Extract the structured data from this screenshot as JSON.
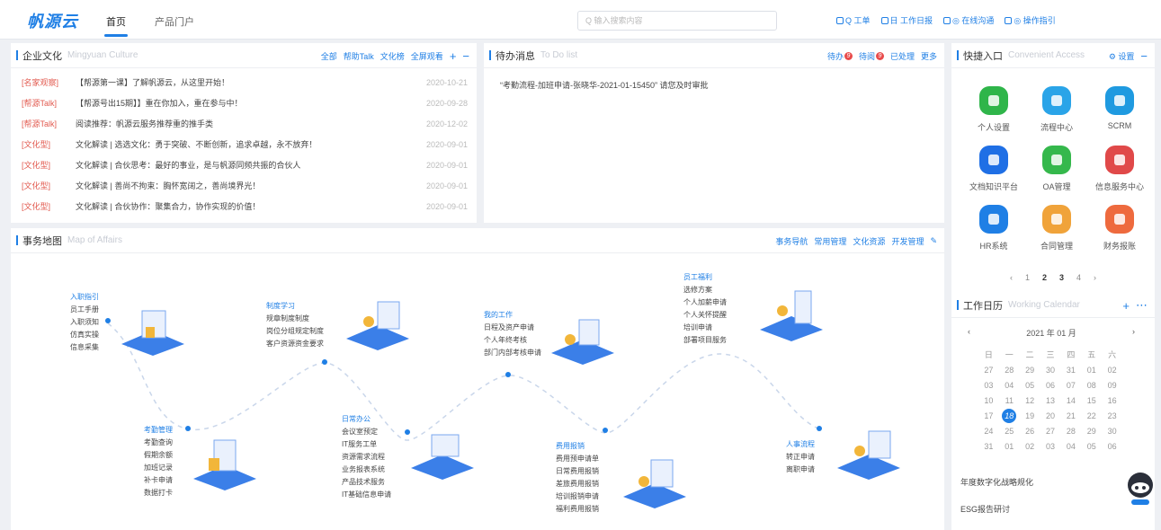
{
  "header": {
    "logo": "帆源云",
    "tabs": [
      "首页",
      "产品门户"
    ],
    "search_placeholder": "Q 输入搜索内容",
    "tools": [
      "Q 工单",
      "日 工作日报",
      "◎ 在线沟通",
      "◎ 操作指引"
    ]
  },
  "culture": {
    "title": "企业文化",
    "en": "Mingyuan Culture",
    "actions": [
      "全部",
      "帮助Talk",
      "文化榜",
      "全屏观看"
    ],
    "rows": [
      {
        "tag": "[名家观察]",
        "text": "【帮源第一课】了解帆源云，从这里开始！",
        "date": "2020-10-21"
      },
      {
        "tag": "[帮源Talk]",
        "text": "【帮源号出15期】】重在你加入，重在参与中！",
        "date": "2020-09-28"
      },
      {
        "tag": "[帮源Talk]",
        "text": "阅读推荐：帆源云服务推荐重的推手类",
        "date": "2020-12-02"
      },
      {
        "tag": "[文化型]",
        "text": "文化解读 | 选选文化：勇于突破、不断创新，追求卓越，永不放弃！",
        "date": "2020-09-01"
      },
      {
        "tag": "[文化型]",
        "text": "文化解读 | 合伙思考：最好的事业，是与帆源同频共振的合伙人",
        "date": "2020-09-01"
      },
      {
        "tag": "[文化型]",
        "text": "文化解读 | 善尚不拘束：胸怀宽阔之，善尚境界光！",
        "date": "2020-09-01"
      },
      {
        "tag": "[文化型]",
        "text": "文化解读 | 合伙协作：聚集合力，协作实现的价值！",
        "date": "2020-09-01"
      }
    ]
  },
  "todo": {
    "title": "待办消息",
    "en": "To Do list",
    "actions": [
      "待办",
      "待阅",
      "已处理",
      "更多"
    ],
    "badge_pending": "9",
    "badge_read": "9",
    "item": "“考勤流程-加班申请-张晓华-2021-01-15450” 请您及时审批"
  },
  "quick": {
    "title": "快捷入口",
    "en": "Convenient Access",
    "settings": "设置",
    "items": [
      {
        "label": "个人设置",
        "color": "#2fb54a"
      },
      {
        "label": "流程中心",
        "color": "#2aa4e8"
      },
      {
        "label": "SCRM",
        "color": "#1f9ae0"
      },
      {
        "label": "文档知识平台",
        "color": "#1f6fe5"
      },
      {
        "label": "OA管理",
        "color": "#35b84c"
      },
      {
        "label": "信息服务中心",
        "color": "#e04949"
      },
      {
        "label": "HR系统",
        "color": "#1f7fe5"
      },
      {
        "label": "合同管理",
        "color": "#f0a33a"
      },
      {
        "label": "财务报账",
        "color": "#ee6a3e"
      }
    ],
    "pages": [
      "‹",
      "1",
      "2",
      "3",
      "4",
      "›"
    ]
  },
  "map": {
    "title": "事务地图",
    "en": "Map of Affairs",
    "actions": [
      "事务导航",
      "常用管理",
      "文化资源",
      "开发管理"
    ],
    "groups": [
      {
        "head": "入职指引",
        "items": [
          "员工手册",
          "入职须知",
          "仿真实操",
          "信息采集"
        ]
      },
      {
        "head": "制度学习",
        "items": [
          "规章制度制度",
          "岗位分组规定制度",
          "客户资源资金要求"
        ]
      },
      {
        "head": "我的工作",
        "items": [
          "日程及资产申请",
          "个人年终考核",
          "部门内部考核申请"
        ]
      },
      {
        "head": "员工福利",
        "items": [
          "选修方案",
          "个人加薪申请",
          "个人关怀提醒",
          "培训申请",
          "部署项目服务"
        ]
      },
      {
        "head": "考勤管理",
        "items": [
          "考勤查询",
          "假期余额",
          "加班记录",
          "补卡申请",
          "数据打卡"
        ]
      },
      {
        "head": "日常办公",
        "items": [
          "会议室预定",
          "IT服务工单",
          "资源需求流程",
          "业务报表系统",
          "产品技术服务",
          "IT基础信息申请"
        ]
      },
      {
        "head": "费用报销",
        "items": [
          "费用预申请单",
          "日常费用报销",
          "差旅费用报销",
          "培训报销申请",
          "福利费用报销"
        ]
      },
      {
        "head": "人事流程",
        "items": [
          "转正申请",
          "离职申请"
        ]
      }
    ]
  },
  "calendar": {
    "title": "工作日历",
    "en": "Working Calendar",
    "month": "2021 年 01 月",
    "weekdays": [
      "日",
      "一",
      "二",
      "三",
      "四",
      "五",
      "六"
    ],
    "weeks": [
      [
        "27",
        "28",
        "29",
        "30",
        "31",
        "01",
        "02"
      ],
      [
        "03",
        "04",
        "05",
        "06",
        "07",
        "08",
        "09"
      ],
      [
        "10",
        "11",
        "12",
        "13",
        "14",
        "15",
        "16"
      ],
      [
        "17",
        "18",
        "19",
        "20",
        "21",
        "22",
        "23"
      ],
      [
        "24",
        "25",
        "26",
        "27",
        "28",
        "29",
        "30"
      ],
      [
        "31",
        "01",
        "02",
        "03",
        "04",
        "05",
        "06"
      ]
    ],
    "today": "18",
    "events": [
      "年度数字化战略规化",
      "ESG报告研讨"
    ]
  }
}
